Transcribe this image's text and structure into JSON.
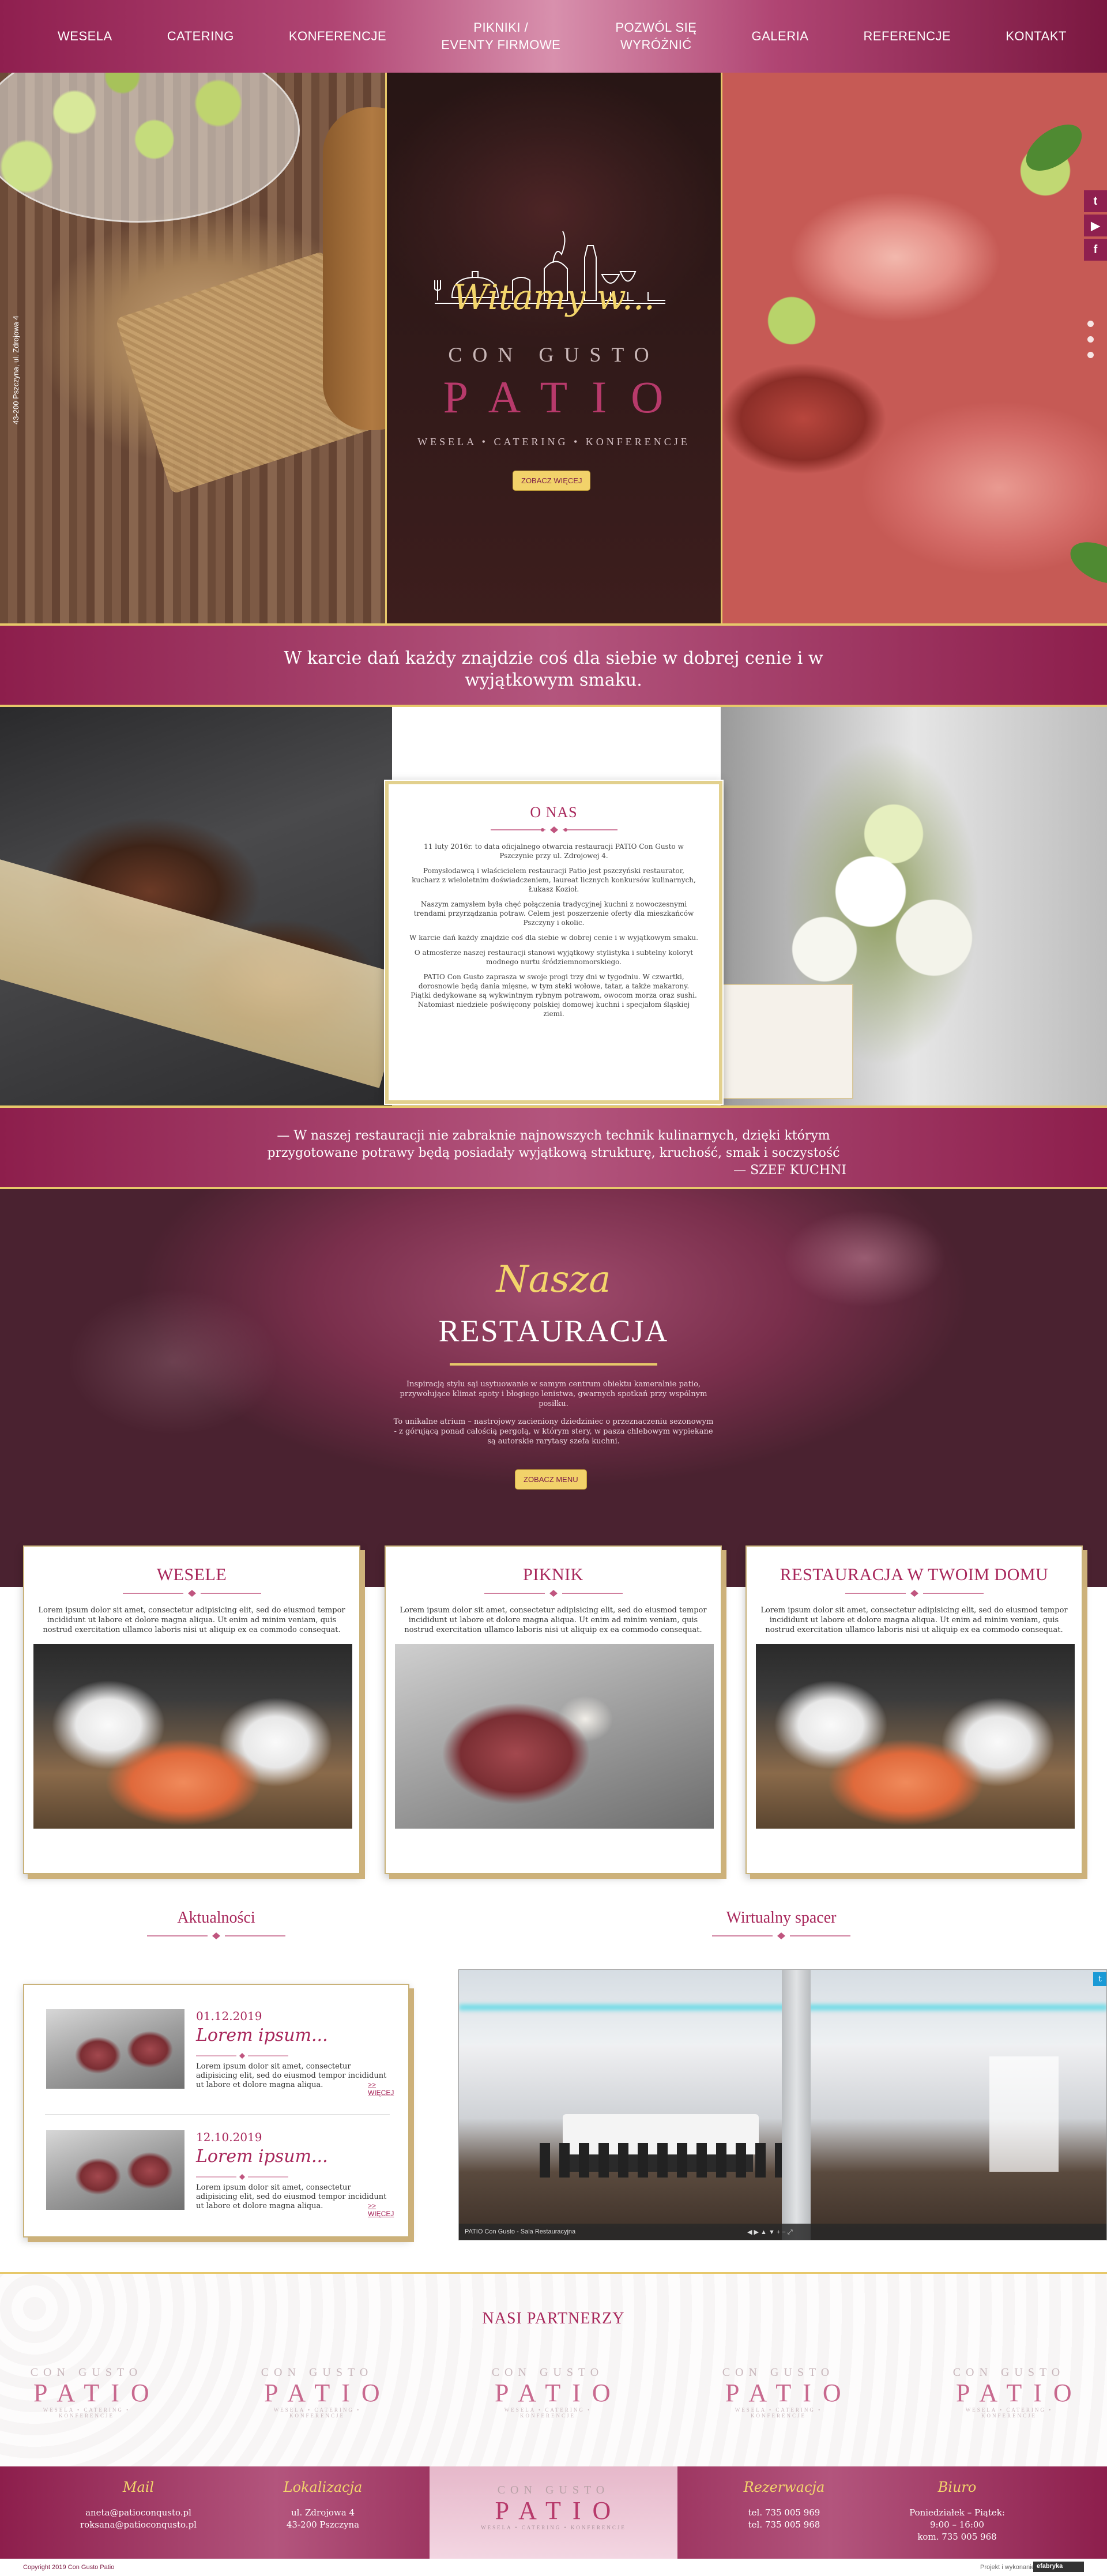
{
  "nav": {
    "items": [
      {
        "label": "WESELA"
      },
      {
        "label": "CATERING"
      },
      {
        "label": "KONFERENCJE"
      },
      {
        "line1": "PIKNIKI /",
        "line2": "EVENTY FIRMOWE"
      },
      {
        "line1": "POZWÓL SIĘ",
        "line2": "WYRÓŻNIĆ"
      },
      {
        "label": "GALERIA"
      },
      {
        "label": "REFERENCJE"
      },
      {
        "label": "KONTAKT"
      }
    ]
  },
  "hero": {
    "side_text": "43-200 Pszczyna, ul. Zdrojowa 4",
    "welcome": "Witamy w...",
    "logo_top": "CON GUSTO",
    "logo_main": "PATIO",
    "logo_sub": "WESELA • CATERING • KONFERENCJE",
    "button": "ZOBACZ WIĘCEJ"
  },
  "social": [
    "t",
    "▶",
    "f"
  ],
  "band1": {
    "line1": "W karcie dań każdy znajdzie coś dla siebie w dobrej cenie i w",
    "line2": "wyjątkowym smaku."
  },
  "about": {
    "title": "O NAS",
    "paragraphs": [
      "11 luty 2016r. to data oficjalnego otwarcia restauracji PATIO Con Gusto w Pszczynie przy ul. Zdrojowej 4.",
      "Pomysłodawcą i właścicielem restauracji Patio jest pszczyński restaurator, kucharz z wieloletnim doświadczeniem, laureat licznych konkursów kulinarnych, Łukasz Kozioł.",
      "Naszym zamysłem była chęć połączenia tradycyjnej kuchni z nowoczesnymi trendami przyrządzania potraw. Celem jest poszerzenie oferty dla mieszkańców Pszczyny i okolic.",
      "W karcie dań każdy znajdzie coś dla siebie w dobrej cenie i w wyjątkowym smaku.",
      "O atmosferze naszej restauracji stanowi wyjątkowy stylistyka i subtelny koloryt modnego nurtu śródziemnomorskiego.",
      "PATIO Con Gusto zaprasza w swoje progi trzy dni w tygodniu. W czwartki, dorosnowie będą dania mięsne, w tym steki wołowe, tatar, a także makarony. Piątki dedykowane są wykwintnym rybnym potrawom, owocom morza oraz sushi. Natomiast niedziele poświęcony polskiej domowej kuchni i specjałom śląskiej ziemi."
    ]
  },
  "band2": {
    "line1": "— W naszej restauracji nie zabraknie najnowszych technik kulinarnych, dzięki którym",
    "line2": "przygotowane potrawy będą posiadały wyjątkową strukturę, kruchość, smak i soczystość",
    "author": "— SZEF KUCHNI"
  },
  "restaurant": {
    "script": "Nasza",
    "title": "RESTAURACJA",
    "p1": "Inspiracją stylu sąi usytuowanie w samym centrum obiektu kameralnie patio, przywołujące klimat spoty i błogiego lenistwa, gwarnych spotkań przy wspólnym posiłku.",
    "p2": "To unikalne atrium – nastrojowy zacieniony dziedziniec o przeznaczeniu sezonowym - z górującą ponad całością pergolą, w którym stery, w pasza chlebowym wypiekane są autorskie rarytasy szefa kuchni.",
    "button": "ZOBACZ MENU"
  },
  "cards": [
    {
      "title": "WESELE",
      "text": "Lorem ipsum dolor sit amet, consectetur adipisicing elit, sed do eiusmod tempor incididunt ut labore et dolore magna aliqua. Ut enim ad minim veniam, quis nostrud exercitation ullamco laboris nisi ut aliquip ex ea commodo consequat."
    },
    {
      "title": "PIKNIK",
      "text": "Lorem ipsum dolor sit amet, consectetur adipisicing elit, sed do eiusmod tempor incididunt ut labore et dolore magna aliqua. Ut enim ad minim veniam, quis nostrud exercitation ullamco laboris nisi ut aliquip ex ea commodo consequat."
    },
    {
      "title": "RESTAURACJA W TWOIM DOMU",
      "text": "Lorem ipsum dolor sit amet, consectetur adipisicing elit, sed do eiusmod tempor incididunt ut labore et dolore magna aliqua. Ut enim ad minim veniam, quis nostrud exercitation ullamco laboris nisi ut aliquip ex ea commodo consequat."
    }
  ],
  "news": {
    "heading": "Aktualności",
    "items": [
      {
        "date": "01.12.2019",
        "title": "Lorem ipsum...",
        "text": "Lorem ipsum dolor sit amet, consectetur adipisicing elit, sed do eiusmod tempor incididunt ut labore et dolore magna aliqua.",
        "more": ">> WIĘCEJ"
      },
      {
        "date": "12.10.2019",
        "title": "Lorem ipsum...",
        "text": "Lorem ipsum dolor sit amet, consectetur adipisicing elit, sed do eiusmod tempor incididunt ut labore et dolore magna aliqua.",
        "more": ">> WIĘCEJ"
      }
    ]
  },
  "virtual": {
    "heading": "Wirtualny spacer",
    "caption": "PATIO Con Gusto - Sala Restauracyjna",
    "controls": "◀ ▶ ▲ ▼ + − ⤢"
  },
  "partners": {
    "heading": "NASI PARTNERZY",
    "logo_top": "CON GUSTO",
    "logo_main": "PATIO",
    "logo_sub": "WESELA • CATERING • KONFERENCJE",
    "count": 5
  },
  "footer": {
    "mail": {
      "heading": "Mail",
      "lines": [
        "aneta@patioconqusto.pl",
        "roksana@patioconqusto.pl"
      ]
    },
    "location": {
      "heading": "Lokalizacja",
      "lines": [
        "ul. Zdrojowa 4",
        "43-200 Pszczyna"
      ]
    },
    "booking": {
      "heading": "Rezerwacja",
      "lines": [
        "tel. 735 005 969",
        "tel. 735 005 968"
      ]
    },
    "office": {
      "heading": "Biuro",
      "lines": [
        "Poniedziałek – Piątek:",
        "9:00 – 16:00",
        "kom. 735 005 968"
      ]
    },
    "logo_top": "CON GUSTO",
    "logo_main": "PATIO",
    "logo_sub": "WESELA • CATERING • KONFERENCJE"
  },
  "copyright": {
    "left": "Copyright 2019 Con Gusto Patio",
    "right": "Projekt i wykonanie:",
    "brand": "efabryka"
  }
}
